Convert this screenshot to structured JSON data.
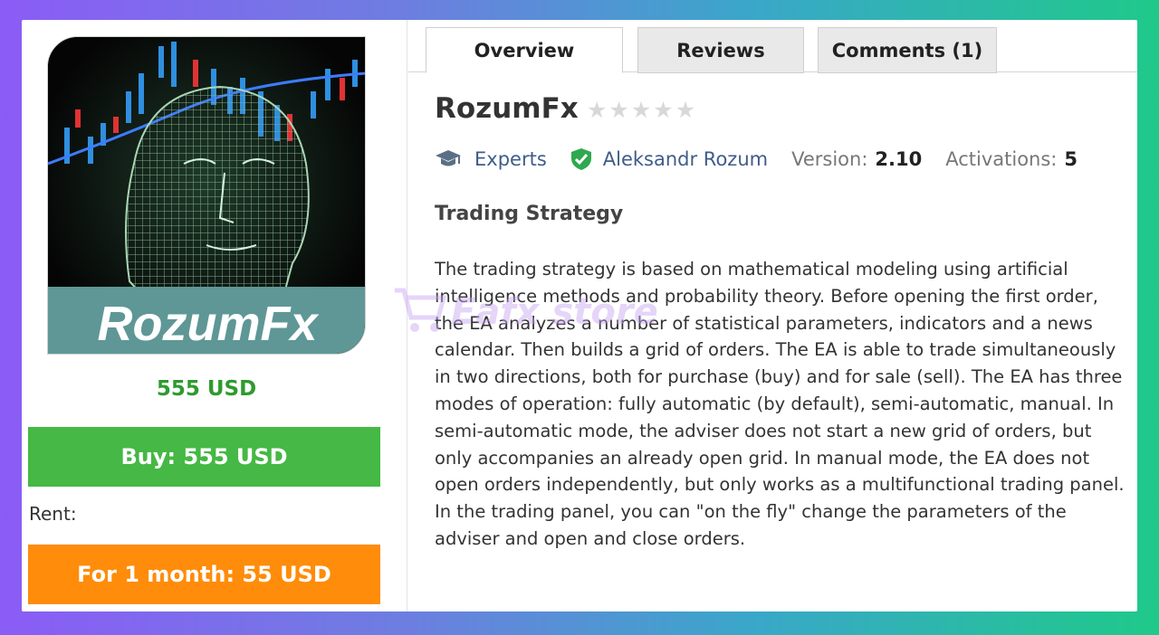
{
  "product": {
    "image_text": "RozumFx",
    "price": "555 USD",
    "buy_label": "Buy: 555 USD",
    "rent_label": "Rent:",
    "rent_button_label": "For 1 month: 55 USD"
  },
  "tabs": [
    {
      "label": "Overview",
      "active": true
    },
    {
      "label": "Reviews",
      "active": false
    },
    {
      "label": "Comments (1)",
      "active": false
    }
  ],
  "header": {
    "title": "RozumFx",
    "rating": 0,
    "rating_max": 5,
    "category": "Experts",
    "category_icon": "graduation-cap-icon",
    "author": "Aleksandr Rozum",
    "author_icon": "verified-shield-icon",
    "version_label": "Version:",
    "version_value": "2.10",
    "activations_label": "Activations:",
    "activations_value": "5"
  },
  "description": {
    "heading": "Trading Strategy",
    "text": "The trading strategy is based on mathematical modeling using artificial intelligence methods and probability theory. Before opening the first order, the EA analyzes a number of statistical parameters, indicators and a news calendar. Then builds a grid of orders. The EA is able to trade simultaneously in two directions, both for purchase (buy) and for sale (sell). The EA has three modes of operation: fully automatic (by default), semi-automatic, manual. In semi-automatic mode, the adviser does not start a new grid of orders, but only accompanies an already open grid. In manual mode, the EA does not open orders independently, but only works as a multifunctional trading panel. In the trading panel, you can \"on the fly\" change the parameters of the adviser and open and close orders."
  },
  "watermark": {
    "text": "Eafx store",
    "icon": "shopping-cart-icon"
  },
  "colors": {
    "buy": "#45b845",
    "rent": "#ff8c0a",
    "price": "#2e9b2e",
    "link": "#3f5c8a",
    "verified": "#2fa84f"
  }
}
